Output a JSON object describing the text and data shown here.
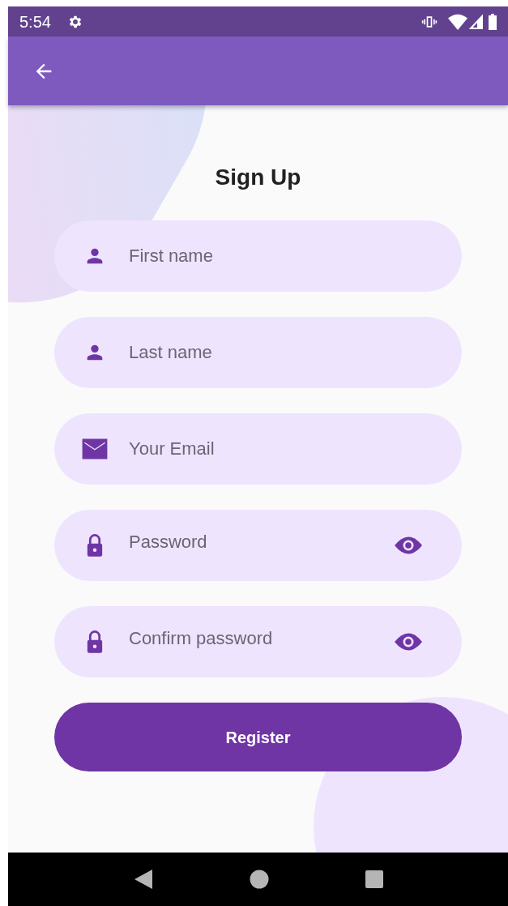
{
  "status_bar": {
    "time": "5:54"
  },
  "title": "Sign Up",
  "fields": [
    {
      "kind": "name",
      "placeholder": "First name"
    },
    {
      "kind": "name",
      "placeholder": "Last name"
    },
    {
      "kind": "email",
      "placeholder": "Your Email"
    },
    {
      "kind": "password",
      "placeholder": "Password",
      "obscured": true
    },
    {
      "kind": "password",
      "placeholder": "Confirm password",
      "obscured": true
    }
  ],
  "register_button": "Register"
}
